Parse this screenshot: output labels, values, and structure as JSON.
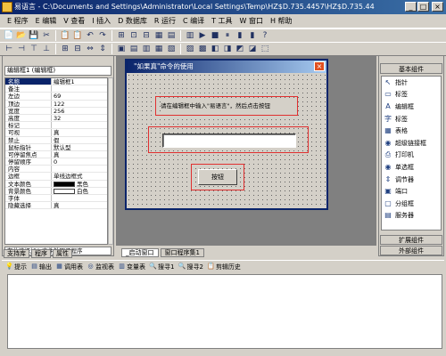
{
  "window": {
    "title": "易语言 - C:\\Documents and Settings\\Administrator\\Local Settings\\Temp\\HZ$D.735.4457\\HZ$D.735.44",
    "min": "_",
    "max": "□",
    "close": "×"
  },
  "menu": [
    "E 程序",
    "E 编辑",
    "V 查看",
    "I 插入",
    "D 数据库",
    "R 运行",
    "C 编译",
    "T 工具",
    "W 窗口",
    "H 帮助"
  ],
  "toolbar1": [
    "📄",
    "📂",
    "💾",
    "✂",
    "📋",
    "📋",
    "↶",
    "↷",
    "⊞",
    "⊡",
    "⊟",
    "▦",
    "▤",
    "▥",
    "▶",
    "■",
    "⏸",
    "▮",
    "▮",
    "?"
  ],
  "toolbar2": [
    "⊢",
    "⊣",
    "⊤",
    "⊥",
    "⊞",
    "⊟",
    "⇔",
    "⇕",
    "▣",
    "▤",
    "▥",
    "▦",
    "▧",
    "▨",
    "▩",
    "◧",
    "◨",
    "◩",
    "◪",
    "⬚"
  ],
  "left_panel": {
    "header": "",
    "object_select": "编辑框1 (编辑框)",
    "properties": [
      {
        "name": "名称",
        "value": "编辑框1"
      },
      {
        "name": "备注",
        "value": ""
      },
      {
        "name": "左边",
        "value": "69"
      },
      {
        "name": "顶边",
        "value": "122"
      },
      {
        "name": "宽度",
        "value": "256"
      },
      {
        "name": "高度",
        "value": "32"
      },
      {
        "name": "标记",
        "value": ""
      },
      {
        "name": "可视",
        "value": "真"
      },
      {
        "name": "禁止",
        "value": "假"
      },
      {
        "name": "鼠标指针",
        "value": "默认型"
      },
      {
        "name": "可停留焦点",
        "value": "真"
      },
      {
        "name": "停留顺序",
        "value": "0"
      },
      {
        "name": "内容",
        "value": ""
      },
      {
        "name": "边框",
        "value": "单线边框式"
      },
      {
        "name": "文本颜色",
        "value": "黑色"
      },
      {
        "name": "背景颜色",
        "value": "白色"
      },
      {
        "name": "字体",
        "value": ""
      },
      {
        "name": "隐藏选择",
        "value": "真"
      }
    ],
    "event_select": "在此选择加入事件处理子程序",
    "tabs": [
      "支持库",
      "程序",
      "属性"
    ]
  },
  "form": {
    "title": "\"如果真\"命令的使用",
    "close": "×",
    "hint_label": "请在编辑框中输入\"易语言\"，然后点击按钮",
    "edit_value": "",
    "button": "按钮"
  },
  "design_tabs": [
    "_启动窗口",
    "窗口程序集1"
  ],
  "right_panel": {
    "basic_tab": "基本组件",
    "components": [
      {
        "icon": "arrow-icon",
        "glyph": "↖",
        "label": "指针"
      },
      {
        "icon": "label-icon",
        "glyph": "▭",
        "label": "标签"
      },
      {
        "icon": "edit-icon",
        "glyph": "A",
        "label": "编辑框"
      },
      {
        "icon": "text-icon",
        "glyph": "字",
        "label": "标签"
      },
      {
        "icon": "table-icon",
        "glyph": "▦",
        "label": "表格"
      },
      {
        "icon": "hyperlink-icon",
        "glyph": "◉",
        "label": "超级链接框"
      },
      {
        "icon": "printer-icon",
        "glyph": "⎙",
        "label": "打印机"
      },
      {
        "icon": "radio-icon",
        "glyph": "◉",
        "label": "单选框"
      },
      {
        "icon": "adjuster-icon",
        "glyph": "⇕",
        "label": "调节器"
      },
      {
        "icon": "port-icon",
        "glyph": "▣",
        "label": "端口"
      },
      {
        "icon": "group-icon",
        "glyph": "▢",
        "label": "分组框"
      },
      {
        "icon": "server-icon",
        "glyph": "▤",
        "label": "服务器"
      }
    ],
    "ext_tab": "扩展组件",
    "ext2_tab": "外部组件"
  },
  "output_tabs": [
    {
      "icon": "tip-icon",
      "glyph": "💡",
      "label": "提示"
    },
    {
      "icon": "output-icon",
      "glyph": "▤",
      "label": "输出"
    },
    {
      "icon": "calltable-icon",
      "glyph": "▦",
      "label": "调用表"
    },
    {
      "icon": "monitor-icon",
      "glyph": "◎",
      "label": "监视表"
    },
    {
      "icon": "vartable-icon",
      "glyph": "▥",
      "label": "变量表"
    },
    {
      "icon": "search1-icon",
      "glyph": "🔍",
      "label": "搜寻1"
    },
    {
      "icon": "search2-icon",
      "glyph": "🔍",
      "label": "搜寻2"
    },
    {
      "icon": "clipboard-icon",
      "glyph": "📋",
      "label": "剪辑历史"
    }
  ],
  "colors": {
    "title_bar": "#0a246a",
    "highlight_box": "#e03030",
    "text_color_swatch": "#000000",
    "bg_color_swatch": "#ffffff"
  }
}
